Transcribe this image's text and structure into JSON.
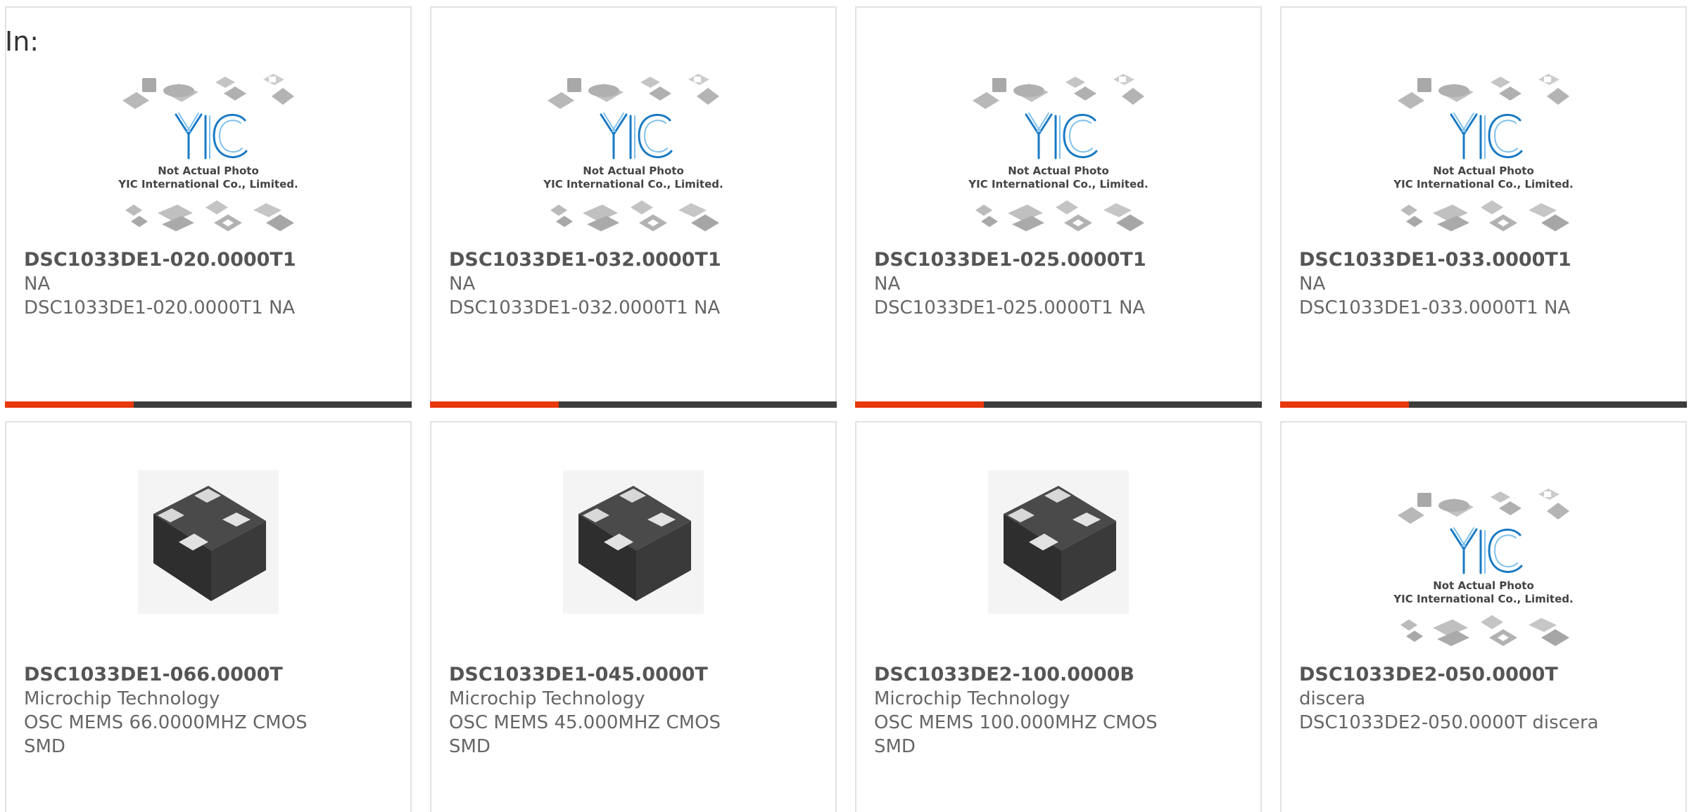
{
  "page": {
    "prefix": "In:"
  },
  "placeholder_image": {
    "logo_text": "YIC",
    "caption_line1": "Not Actual Photo",
    "caption_line2": "YIC International Co., Limited."
  },
  "products": [
    {
      "part_number": "DSC1033DE1-020.0000T1",
      "manufacturer": "NA",
      "description": "DSC1033DE1-020.0000T1 NA",
      "description_2": "",
      "image": "placeholder-photo-icon"
    },
    {
      "part_number": "DSC1033DE1-032.0000T1",
      "manufacturer": "NA",
      "description": "DSC1033DE1-032.0000T1 NA",
      "description_2": "",
      "image": "placeholder-photo-icon"
    },
    {
      "part_number": "DSC1033DE1-025.0000T1",
      "manufacturer": "NA",
      "description": "DSC1033DE1-025.0000T1 NA",
      "description_2": "",
      "image": "placeholder-photo-icon"
    },
    {
      "part_number": "DSC1033DE1-033.0000T1",
      "manufacturer": "NA",
      "description": "DSC1033DE1-033.0000T1 NA",
      "description_2": "",
      "image": "placeholder-photo-icon"
    },
    {
      "part_number": "DSC1033DE1-066.0000T",
      "manufacturer": "Microchip Technology",
      "description": "OSC MEMS 66.0000MHZ CMOS",
      "description_2": "SMD",
      "image": "chip-package-icon"
    },
    {
      "part_number": "DSC1033DE1-045.0000T",
      "manufacturer": "Microchip Technology",
      "description": "OSC MEMS 45.000MHZ CMOS",
      "description_2": "SMD",
      "image": "chip-package-icon"
    },
    {
      "part_number": "DSC1033DE2-100.0000B",
      "manufacturer": "Microchip Technology",
      "description": "OSC MEMS 100.000MHZ CMOS",
      "description_2": "SMD",
      "image": "chip-package-icon"
    },
    {
      "part_number": "DSC1033DE2-050.0000T",
      "manufacturer": "discera",
      "description": "DSC1033DE2-050.0000T discera",
      "description_2": "",
      "image": "placeholder-photo-icon"
    }
  ],
  "colors": {
    "accent": "#e8380d",
    "bar_dark": "#3c3c3c",
    "logo_blue": "#1a7ac4",
    "text": "#666666"
  }
}
